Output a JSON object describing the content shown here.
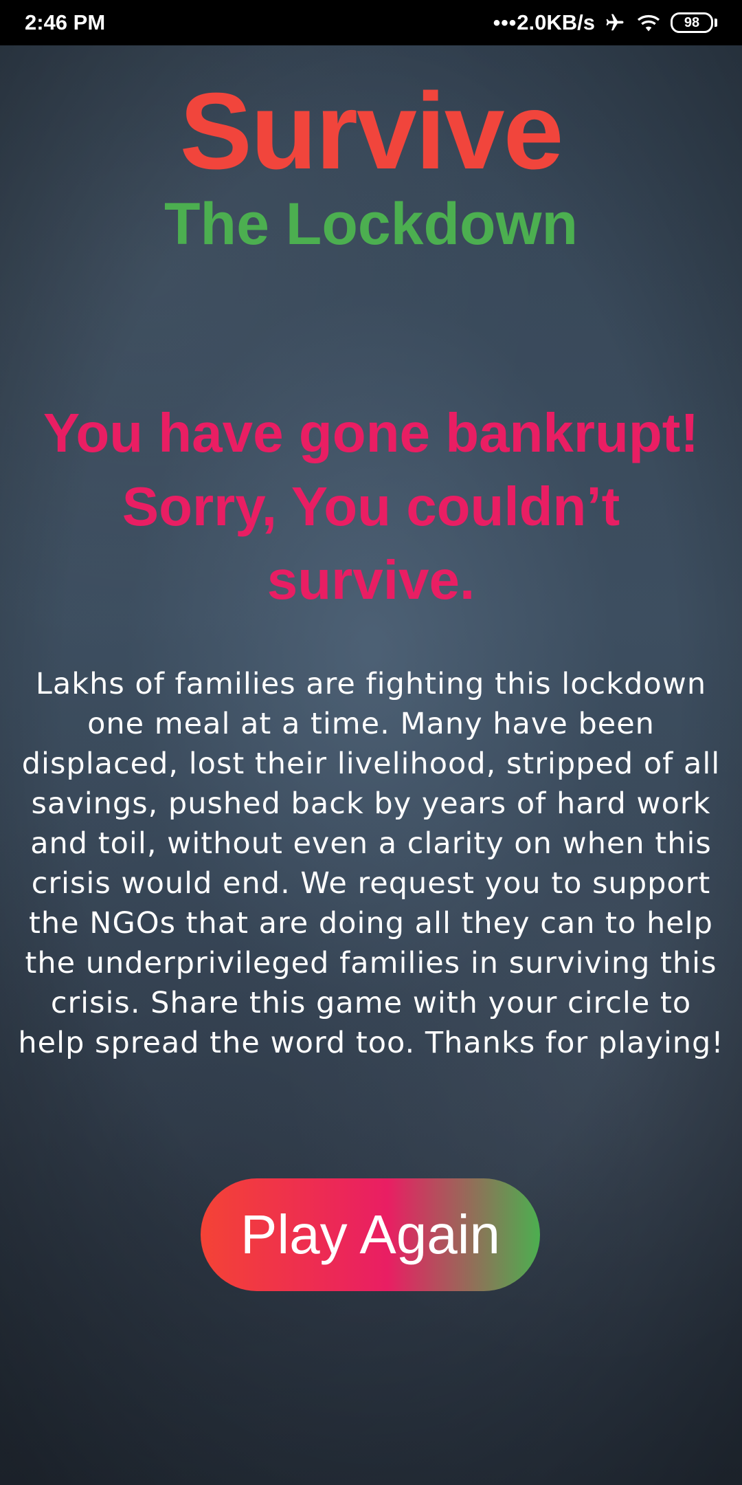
{
  "status_bar": {
    "time": "2:46 PM",
    "signal_dots": "•••",
    "network_speed": "2.0KB/s",
    "battery_level": "98",
    "icons": [
      "airplane-icon",
      "wifi-icon",
      "battery-icon"
    ]
  },
  "header": {
    "title": "Survive",
    "subtitle": "The Lockdown"
  },
  "result": {
    "message": "You have gone bankrupt! Sorry, You couldn’t survive."
  },
  "body": {
    "text": "Lakhs of families are fighting this lockdown one meal at a time. Many have been displaced, lost their livelihood, stripped of all savings, pushed back by years of hard work and toil, without even a clarity on when this crisis would end. We request you to support the NGOs that are doing all they can to help the underprivileged families in surviving this crisis. Share this game with your circle to help spread the word too. Thanks for playing!"
  },
  "actions": {
    "play_again_label": "Play Again"
  },
  "colors": {
    "title": "#f1453c",
    "subtitle": "#4caf50",
    "result_message": "#e91e63",
    "button_gradient": [
      "#f44336",
      "#e91e63",
      "#4caf50"
    ],
    "background": "#3d4e5f"
  }
}
